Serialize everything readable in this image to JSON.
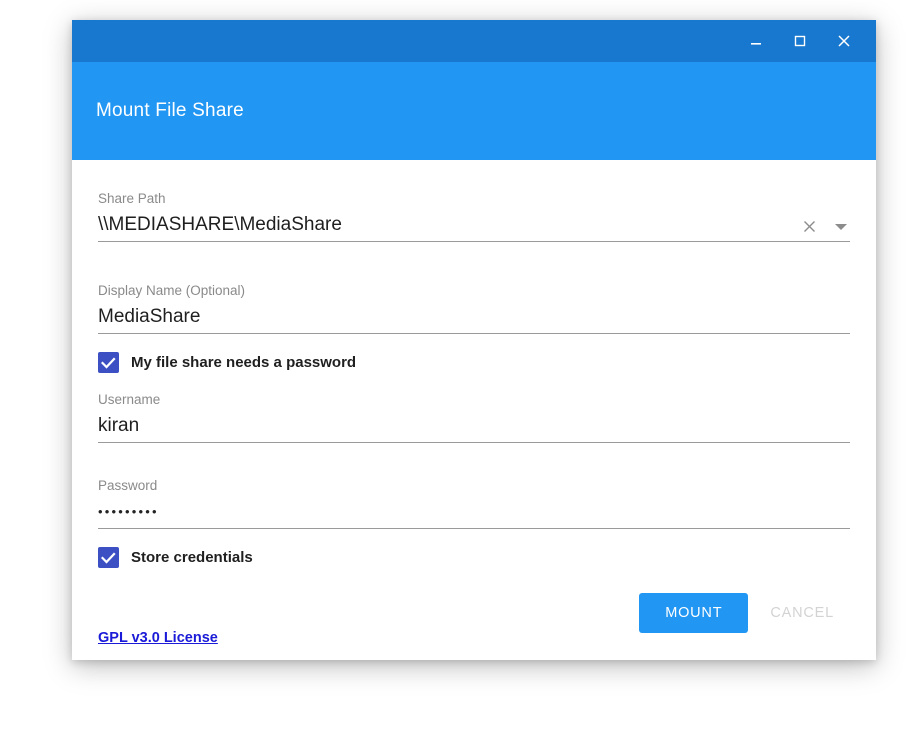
{
  "window": {
    "controls": [
      {
        "name": "minimize-button",
        "icon": "minimize-icon",
        "label": "_"
      },
      {
        "name": "maximize-button",
        "icon": "maximize-icon",
        "label": "□"
      },
      {
        "name": "close-button",
        "icon": "close-icon",
        "label": "✕"
      }
    ]
  },
  "header": {
    "title": "Mount File Share"
  },
  "form": {
    "share_path": {
      "label": "Share Path",
      "value": "\\\\MEDIASHARE\\MediaShare",
      "placeholder": "",
      "clear_icon": "clear-icon",
      "dropdown_icon": "dropdown-caret-icon"
    },
    "display_name": {
      "label": "Display Name (Optional)",
      "value": "MediaShare",
      "placeholder": ""
    },
    "needs_password": {
      "label": "My file share needs a password",
      "checked": true
    },
    "username": {
      "label": "Username",
      "value": "kiran",
      "placeholder": ""
    },
    "password": {
      "label": "Password",
      "value": "•••••••••",
      "placeholder": ""
    },
    "store_credentials": {
      "label": "Store credentials",
      "checked": true
    }
  },
  "footer": {
    "license_link": "GPL v3.0 License",
    "mount_label": "MOUNT",
    "cancel_label": "CANCEL"
  },
  "colors": {
    "titlebar": "#1877ce",
    "header": "#2196f3",
    "accent_button": "#2196f3",
    "checkbox": "#3d50c3",
    "link": "#1a1ad8",
    "cancel_disabled": "#d3d3d3"
  }
}
